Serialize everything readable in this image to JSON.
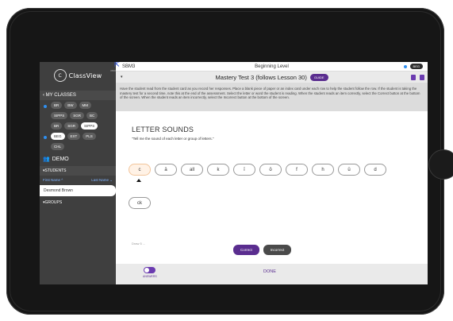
{
  "app": {
    "logo_text": "ClassView",
    "logo_sub": "PRO"
  },
  "sidebar": {
    "my_classes": "MY CLASSES",
    "class_groups": [
      {
        "chips": [
          "BR",
          "BW",
          "MM"
        ],
        "selected": null,
        "dot": true
      },
      {
        "chips": [
          "SIPPS",
          "SGR",
          "BC"
        ],
        "selected": null,
        "dot": false
      },
      {
        "chips": [
          "BR",
          "SGR",
          "SIPPS"
        ],
        "selected": "SIPPS",
        "dot": false
      },
      {
        "chips": [
          "BEG",
          "EXT",
          "PLS"
        ],
        "selected": "BEG",
        "dot": true
      },
      {
        "chips": [
          "CHL"
        ],
        "selected": null,
        "dot": false
      }
    ],
    "demo": "DEMO",
    "students": "STUDENTS",
    "first_name": "First Name ^",
    "last_name": "Last Name ⌄",
    "student": "Desmond Brown",
    "groups": "GROUPS"
  },
  "header": {
    "code": "SBM3",
    "level": "Beginning Level",
    "badge": "BEG"
  },
  "test": {
    "title": "Mastery Test 3 (follows Lesson 30)",
    "guide": "GUIDE"
  },
  "instructions": "Have the student read from the student card as you record her responses. Place a blank piece of paper or an index card under each row to help the student follow the row. If the student is taking the mastery test for a second time, note this at the end of the assessment. Select the letter or word the student is reading. When the student reads an item correctly, select the Correct button at the bottom of the screen. When the student reads an item incorrectly, select the Incorrect button at the bottom of the screen.",
  "section": {
    "title": "LETTER SOUNDS",
    "prompt": "\"Tell me the sound of each letter or group of letters.\"",
    "items": [
      "c",
      "ā",
      "all",
      "k",
      "ī",
      "ō",
      "f",
      "h",
      "ū",
      "d"
    ],
    "item_ck": "ck",
    "active_index": 0
  },
  "actions": {
    "correct": "Correct",
    "incorrect": "Incorrect"
  },
  "bottom": {
    "answers": "ANSWERS",
    "done": "DONE"
  }
}
